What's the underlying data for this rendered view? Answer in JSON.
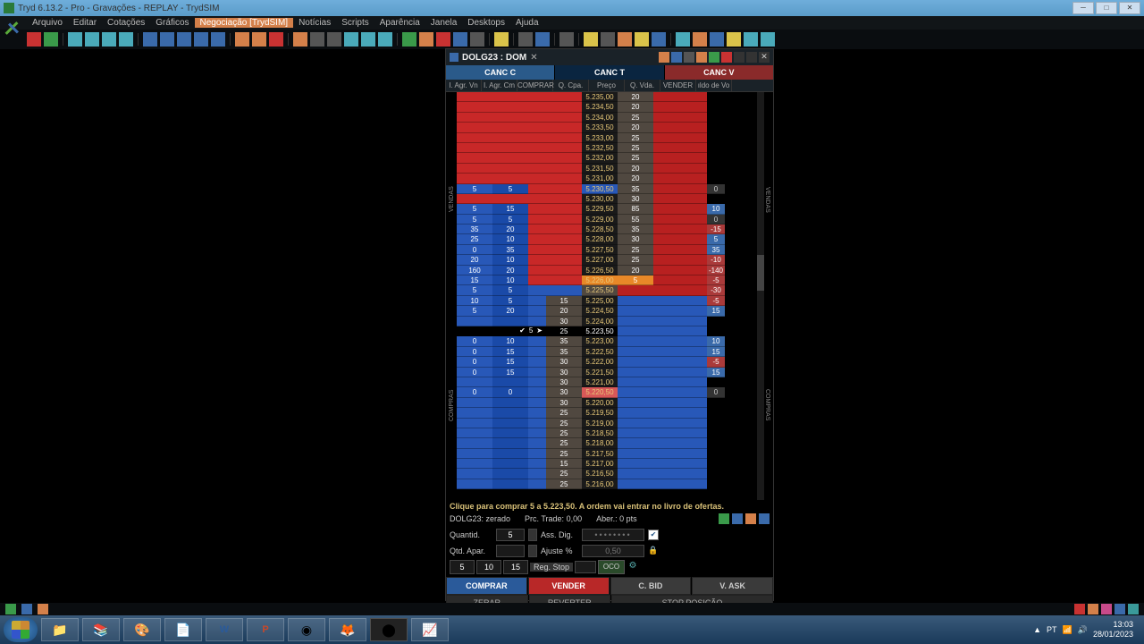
{
  "title": "Tryd 6.13.2 - Pro - Gravações - REPLAY - TrydSIM",
  "menu": [
    "Arquivo",
    "Editar",
    "Cotações",
    "Gráficos",
    "Negociação [TrydSIM]",
    "Notícias",
    "Scripts",
    "Aparência",
    "Janela",
    "Desktops",
    "Ajuda"
  ],
  "menu_active": 4,
  "dom": {
    "title": "DOLG23 : DOM",
    "cancel": {
      "c": "CANC C",
      "t": "CANC T",
      "v": "CANC V"
    },
    "headers": [
      "I. Agr. Vn",
      "I. Agr. Cm",
      "COMPRAR",
      "Q. Cpa.",
      "Preço",
      "Q. Vda.",
      "VENDER",
      "ıldo de Vo"
    ],
    "side_labels": {
      "vendas": "VENDAS",
      "compras": "COMPRAS"
    },
    "cursor": {
      "qty": "5",
      "check": "✔",
      "arrow": "➤"
    },
    "rows": [
      {
        "prc": "5.235,00",
        "qv": "20"
      },
      {
        "prc": "5.234,50",
        "qv": "20"
      },
      {
        "prc": "5.234,00",
        "qv": "25"
      },
      {
        "prc": "5.233,50",
        "qv": "20"
      },
      {
        "prc": "5.233,00",
        "qv": "25"
      },
      {
        "prc": "5.232,50",
        "qv": "25"
      },
      {
        "prc": "5.232,00",
        "qv": "25"
      },
      {
        "prc": "5.231,50",
        "qv": "20"
      },
      {
        "prc": "5.231,00",
        "qv": "20"
      },
      {
        "agv": "5",
        "agc": "5",
        "prc": "5.230,50",
        "qv": "35",
        "sv": "0",
        "svc": "z",
        "prcHL": true
      },
      {
        "prc": "5.230,00",
        "qv": "30"
      },
      {
        "agv": "5",
        "agc": "15",
        "prc": "5.229,50",
        "qv": "85",
        "sv": "10",
        "svc": "p"
      },
      {
        "agv": "5",
        "agc": "5",
        "prc": "5.229,00",
        "qv": "55",
        "sv": "0",
        "svc": "z"
      },
      {
        "agv": "35",
        "agc": "20",
        "prc": "5.228,50",
        "qv": "35",
        "sv": "-15",
        "svc": "n"
      },
      {
        "agv": "25",
        "agc": "10",
        "prc": "5.228,00",
        "qv": "30",
        "sv": "5",
        "svc": "p"
      },
      {
        "agv": "0",
        "agc": "35",
        "prc": "5.227,50",
        "qv": "25",
        "sv": "35",
        "svc": "p"
      },
      {
        "agv": "20",
        "agc": "10",
        "prc": "5.227,00",
        "qv": "25",
        "sv": "-10",
        "svc": "n"
      },
      {
        "agv": "160",
        "agc": "20",
        "prc": "5.226,50",
        "qv": "20",
        "sv": "-140",
        "svc": "n"
      },
      {
        "agv": "15",
        "agc": "10",
        "prc": "5.226,00",
        "qv": "5",
        "sv": "-5",
        "svc": "n",
        "bestAsk": true
      },
      {
        "agv": "5",
        "agc": "5",
        "prc": "5.225,50",
        "sv": "-30",
        "svc": "n",
        "spread": true
      },
      {
        "agv": "10",
        "agc": "5",
        "qc": "15",
        "prc": "5.225,00",
        "sv": "-5",
        "svc": "n",
        "bestBid": true
      },
      {
        "agv": "5",
        "agc": "20",
        "qc": "20",
        "prc": "5.224,50",
        "sv": "15",
        "svc": "p"
      },
      {
        "qc": "30",
        "prc": "5.224,00"
      },
      {
        "qc": "25",
        "prc": "5.223,50",
        "cursor": true
      },
      {
        "agv": "0",
        "agc": "10",
        "qc": "35",
        "prc": "5.223,00",
        "sv": "10",
        "svc": "p"
      },
      {
        "agv": "0",
        "agc": "15",
        "qc": "35",
        "prc": "5.222,50",
        "sv": "15",
        "svc": "p"
      },
      {
        "agv": "0",
        "agc": "15",
        "qc": "30",
        "prc": "5.222,00",
        "sv": "-5",
        "svc": "n"
      },
      {
        "agv": "0",
        "agc": "15",
        "qc": "30",
        "prc": "5.221,50",
        "sv": "15",
        "svc": "p"
      },
      {
        "qc": "30",
        "prc": "5.221,00"
      },
      {
        "agv": "0",
        "agc": "0",
        "qc": "30",
        "prc": "5.220,50",
        "sv": "0",
        "svc": "z",
        "pink": true
      },
      {
        "qc": "30",
        "prc": "5.220,00"
      },
      {
        "qc": "25",
        "prc": "5.219,50"
      },
      {
        "qc": "25",
        "prc": "5.219,00"
      },
      {
        "qc": "25",
        "prc": "5.218,50"
      },
      {
        "qc": "25",
        "prc": "5.218,00"
      },
      {
        "qc": "25",
        "prc": "5.217,50"
      },
      {
        "qc": "15",
        "prc": "5.217,00"
      },
      {
        "qc": "25",
        "prc": "5.216,50"
      },
      {
        "qc": "25",
        "prc": "5.216,00"
      }
    ],
    "status_msg": "Clique para comprar 5 a 5.223,50. A ordem vai entrar no livro de ofertas.",
    "position": {
      "sym": "DOLG23: zerado",
      "prc": "Prc. Trade: 0,00",
      "aber": "Aber.: 0 pts"
    },
    "ctrl": {
      "quantid_lbl": "Quantid.",
      "quantid": "5",
      "qtdapar_lbl": "Qtd. Apar.",
      "assdig_lbl": "Ass. Dig.",
      "assdig_ph": "••••••••",
      "ajuste_lbl": "Ajuste %",
      "ajuste_ph": "0,50",
      "qty1": "5",
      "qty2": "10",
      "qty3": "15",
      "regstop": "Reg. Stop",
      "oco": "OCO"
    },
    "buttons": {
      "comprar": "COMPRAR",
      "vender": "VENDER",
      "cbid": "C. BID",
      "vask": "V. ASK",
      "zerar": "ZERAR",
      "reverter": "REVERTER",
      "stoppos": "STOP POSIÇÃO"
    }
  },
  "tray": {
    "lang": "PT",
    "time": "13:03",
    "date": "28/01/2023"
  }
}
